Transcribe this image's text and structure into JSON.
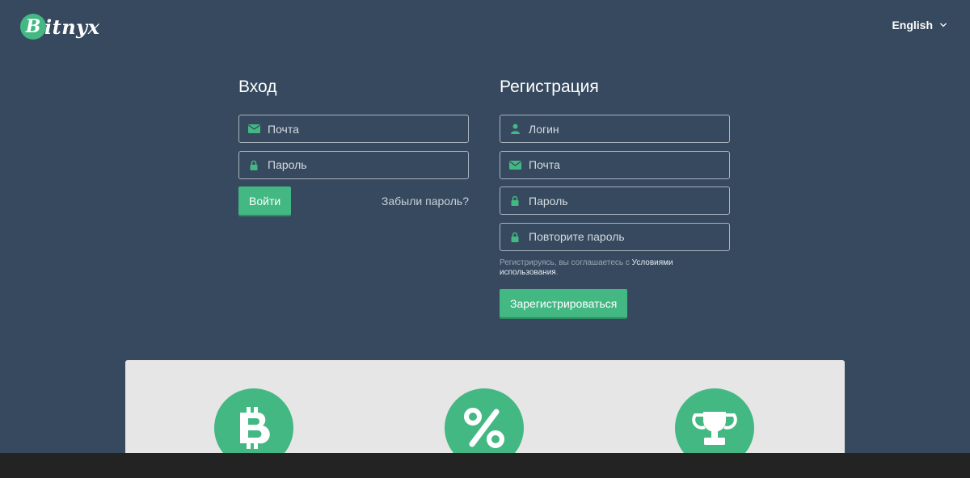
{
  "header": {
    "logo_letter": "B",
    "logo_text": "itnyx",
    "language": "English"
  },
  "login": {
    "title": "Вход",
    "email_placeholder": "Почта",
    "password_placeholder": "Пароль",
    "submit_label": "Войти",
    "forgot_label": "Забыли пароль?"
  },
  "register": {
    "title": "Регистрация",
    "login_placeholder": "Логин",
    "email_placeholder": "Почта",
    "password_placeholder": "Пароль",
    "repeat_password_placeholder": "Повторите пароль",
    "terms_prefix": "Регистрируясь, вы соглашаетесь с ",
    "terms_link": "Условиями использования",
    "terms_suffix": ".",
    "submit_label": "Зарегистрироваться"
  },
  "features": {
    "icons": [
      "bitcoin-icon",
      "percent-icon",
      "trophy-icon"
    ]
  },
  "colors": {
    "background": "#36495e",
    "accent": "#43b883",
    "features_bg": "#e6e6e6",
    "footer": "#232323"
  }
}
